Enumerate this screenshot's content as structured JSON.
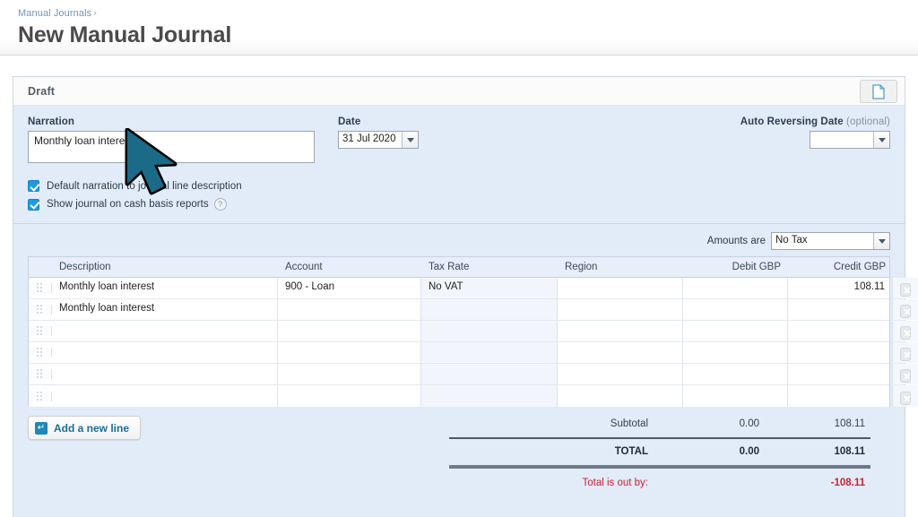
{
  "header": {
    "breadcrumb": "Manual Journals",
    "breadcrumb_separator": "›",
    "title": "New Manual Journal"
  },
  "card": {
    "status": "Draft",
    "file_icon": "document-page-icon"
  },
  "form": {
    "narration": {
      "label": "Narration",
      "value": "Monthly loan interest"
    },
    "date": {
      "label": "Date",
      "value": "31 Jul 2020"
    },
    "auto_reversing_date": {
      "label": "Auto Reversing Date",
      "optional_suffix": "(optional)",
      "value": ""
    },
    "checkboxes": [
      {
        "label": "Default narration to journal line description",
        "checked": true
      },
      {
        "label": "Show journal on cash basis reports",
        "checked": true,
        "help": "?"
      }
    ],
    "amounts_are": {
      "label": "Amounts are",
      "value": "No Tax"
    }
  },
  "grid": {
    "columns": [
      "Description",
      "Account",
      "Tax Rate",
      "Region",
      "Debit GBP",
      "Credit GBP"
    ],
    "rows": [
      {
        "description": "Monthly loan interest",
        "account": "900 - Loan",
        "tax_rate": "No VAT",
        "region": "",
        "debit": "",
        "credit": "108.11"
      },
      {
        "description": "Monthly loan interest",
        "account": "",
        "tax_rate": "",
        "region": "",
        "debit": "",
        "credit": ""
      },
      {
        "description": "",
        "account": "",
        "tax_rate": "",
        "region": "",
        "debit": "",
        "credit": ""
      },
      {
        "description": "",
        "account": "",
        "tax_rate": "",
        "region": "",
        "debit": "",
        "credit": ""
      },
      {
        "description": "",
        "account": "",
        "tax_rate": "",
        "region": "",
        "debit": "",
        "credit": ""
      },
      {
        "description": "",
        "account": "",
        "tax_rate": "",
        "region": "",
        "debit": "",
        "credit": ""
      }
    ]
  },
  "footer": {
    "add_line_label": "Add a new line",
    "add_line_icon": "enter-arrow-icon",
    "subtotal": {
      "label": "Subtotal",
      "debit": "0.00",
      "credit": "108.11"
    },
    "total": {
      "label": "TOTAL",
      "debit": "0.00",
      "credit": "108.11"
    },
    "out_by": {
      "label": "Total is out by:",
      "value": "-108.11"
    }
  },
  "colors": {
    "form_background": "#e2ebf8",
    "accent_link": "#1c6e96",
    "error_red": "#cc2233",
    "checkbox_blue": "#1f9ae0",
    "cursor_fill": "#1b6a87"
  }
}
